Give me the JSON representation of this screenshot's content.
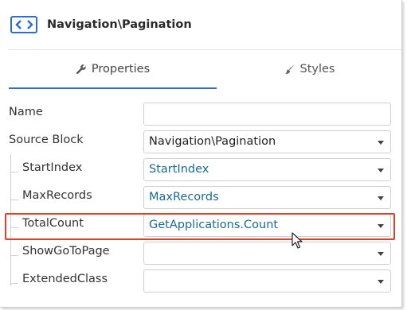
{
  "header": {
    "title": "Navigation\\Pagination",
    "icon": "navigation-block-icon"
  },
  "tabs": [
    {
      "label": "Properties",
      "icon": "wrench-icon",
      "active": true
    },
    {
      "label": "Styles",
      "icon": "brush-icon",
      "active": false
    }
  ],
  "properties": [
    {
      "label": "Name",
      "value": "",
      "dropdown": false,
      "sub": false
    },
    {
      "label": "Source Block",
      "value": "Navigation\\Pagination",
      "dropdown": true,
      "sub": false
    },
    {
      "label": "StartIndex",
      "value": "StartIndex",
      "dropdown": true,
      "sub": true
    },
    {
      "label": "MaxRecords",
      "value": "MaxRecords",
      "dropdown": true,
      "sub": true
    },
    {
      "label": "TotalCount",
      "value": "GetApplications.Count",
      "dropdown": true,
      "sub": true,
      "highlighted": true
    },
    {
      "label": "ShowGoToPage",
      "value": "",
      "dropdown": true,
      "sub": true
    },
    {
      "label": "ExtendedClass",
      "value": "",
      "dropdown": true,
      "sub": true
    }
  ],
  "colors": {
    "accent": "#2b6cd6",
    "highlight": "#d9432b",
    "link": "#1a6b8f"
  }
}
